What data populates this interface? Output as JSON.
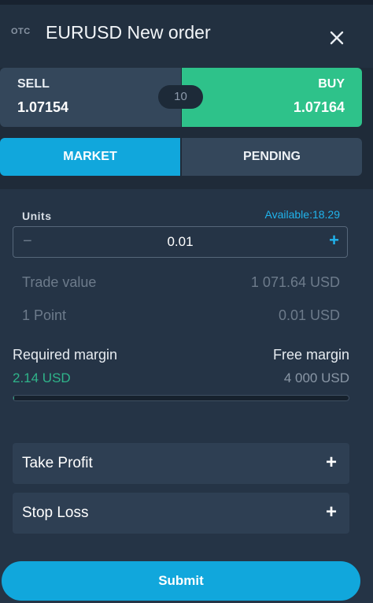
{
  "header": {
    "badge": "OTC",
    "title": "EURUSD New order",
    "close_icon": "close-icon"
  },
  "prices": {
    "sell_label": "SELL",
    "sell_price": "1.07154",
    "buy_label": "BUY",
    "buy_price": "1.07164",
    "spread": "10"
  },
  "tabs": [
    {
      "label": "MARKET",
      "active": true
    },
    {
      "label": "PENDING",
      "active": false
    }
  ],
  "units": {
    "label": "Units",
    "available": "Available:18.29",
    "value": "0.01",
    "minus": "−",
    "plus": "+"
  },
  "info": [
    {
      "label": "Trade value",
      "value": "1 071.64 USD"
    },
    {
      "label": "1 Point",
      "value": "0.01 USD"
    }
  ],
  "margin": {
    "required_label": "Required margin",
    "required_value": "2.14 USD",
    "free_label": "Free margin",
    "free_value": "4 000 USD",
    "usage_fraction": 0.0005
  },
  "accordions": [
    {
      "label": "Take Profit",
      "icon": "+"
    },
    {
      "label": "Stop Loss",
      "icon": "+"
    }
  ],
  "submit_label": "Submit",
  "colors": {
    "accent": "#11a7dc",
    "buy": "#2ec28a",
    "sell": "#34475b",
    "background": "#253446"
  }
}
